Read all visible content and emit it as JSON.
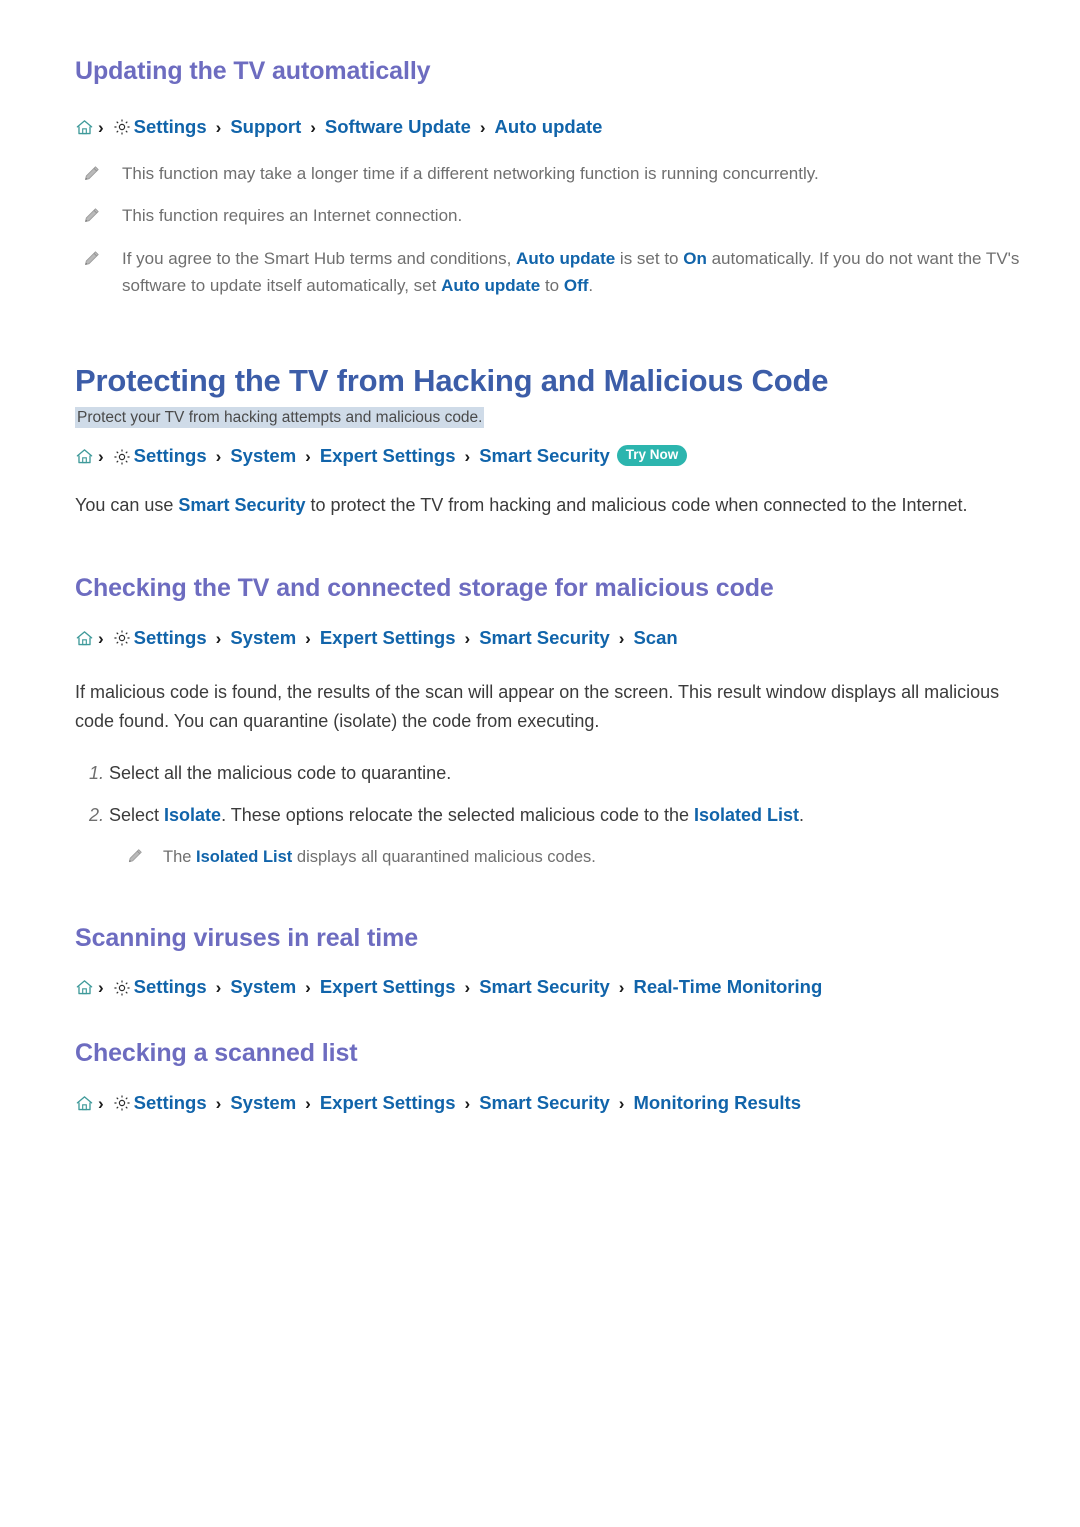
{
  "sections": [
    {
      "id": "updating-tv-automatically",
      "heading": "Updating the TV automatically",
      "breadcrumb": {
        "home_icon": "home-icon",
        "gear_icon": "gear-icon",
        "separator": "›",
        "crumbs": [
          "Settings",
          "Support",
          "Software Update",
          "Auto update"
        ]
      },
      "notes": [
        {
          "icon": "pencil-icon",
          "parts": [
            {
              "t": "This function may take a longer time if a different networking function is running concurrently.",
              "style": "plain"
            }
          ]
        },
        {
          "icon": "pencil-icon",
          "parts": [
            {
              "t": "This function requires an Internet connection.",
              "style": "plain"
            }
          ]
        },
        {
          "icon": "pencil-icon",
          "parts": [
            {
              "t": "If you agree to the Smart Hub terms and conditions, ",
              "style": "plain"
            },
            {
              "t": "Auto update",
              "style": "link"
            },
            {
              "t": " is set to ",
              "style": "plain"
            },
            {
              "t": "On",
              "style": "link"
            },
            {
              "t": " automatically. If you do not want the TV's software to update itself automatically, set ",
              "style": "plain"
            },
            {
              "t": "Auto update",
              "style": "link"
            },
            {
              "t": " to ",
              "style": "plain"
            },
            {
              "t": "Off",
              "style": "link"
            },
            {
              "t": ".",
              "style": "plain"
            }
          ]
        }
      ]
    }
  ],
  "doc": {
    "title": "Protecting the TV from Hacking and Malicious Code",
    "subtitle": "Protect your TV from hacking attempts and malicious code.",
    "breadcrumb": {
      "crumbs": [
        "Settings",
        "System",
        "Expert Settings",
        "Smart Security"
      ],
      "badge": "Try Now"
    },
    "intro": [
      {
        "t": "You can use ",
        "style": "plain"
      },
      {
        "t": "Smart Security",
        "style": "link"
      },
      {
        "t": " to protect the TV from hacking and malicious code when connected to the Internet.",
        "style": "plain"
      }
    ]
  },
  "section_scan": {
    "heading": "Checking the TV and connected storage for malicious code",
    "breadcrumb": {
      "crumbs": [
        "Settings",
        "System",
        "Expert Settings",
        "Smart Security",
        "Scan"
      ]
    },
    "paragraph": "If malicious code is found, the results of the scan will appear on the screen. This result window displays all malicious code found. You can quarantine (isolate) the code from executing.",
    "steps": [
      {
        "num": "1.",
        "parts": [
          {
            "t": "Select all the malicious code to quarantine.",
            "style": "plain"
          }
        ]
      },
      {
        "num": "2.",
        "parts": [
          {
            "t": "Select ",
            "style": "plain"
          },
          {
            "t": "Isolate",
            "style": "link"
          },
          {
            "t": ". These options relocate the selected malicious code to the ",
            "style": "plain"
          },
          {
            "t": "Isolated List",
            "style": "link"
          },
          {
            "t": ".",
            "style": "plain"
          }
        ]
      }
    ],
    "substep_note": {
      "icon": "pencil-icon",
      "parts": [
        {
          "t": "The ",
          "style": "plain"
        },
        {
          "t": "Isolated List",
          "style": "link"
        },
        {
          "t": " displays all quarantined malicious codes.",
          "style": "plain"
        }
      ]
    }
  },
  "section_realtime": {
    "heading": "Scanning viruses in real time",
    "breadcrumb": {
      "crumbs": [
        "Settings",
        "System",
        "Expert Settings",
        "Smart Security",
        "Real-Time Monitoring"
      ]
    }
  },
  "section_scanned_list": {
    "heading": "Checking a scanned list",
    "breadcrumb": {
      "crumbs": [
        "Settings",
        "System",
        "Expert Settings",
        "Smart Security",
        "Monitoring Results"
      ]
    }
  },
  "icons": {
    "home": "home-icon",
    "gear": "gear-icon",
    "pencil": "pencil-icon",
    "chevron": "chevron-right-icon"
  },
  "colors": {
    "doc_title": "#3c5da8",
    "section_title": "#6d6cc0",
    "link": "#1164aa",
    "body_text": "#3b3b3b",
    "note_text": "#6f6f6f",
    "badge_bg": "#2cb5ae",
    "badge_text": "#ffffff",
    "highlight_bg": "#cfdbe8",
    "home_icon": "#3f9a9a"
  }
}
